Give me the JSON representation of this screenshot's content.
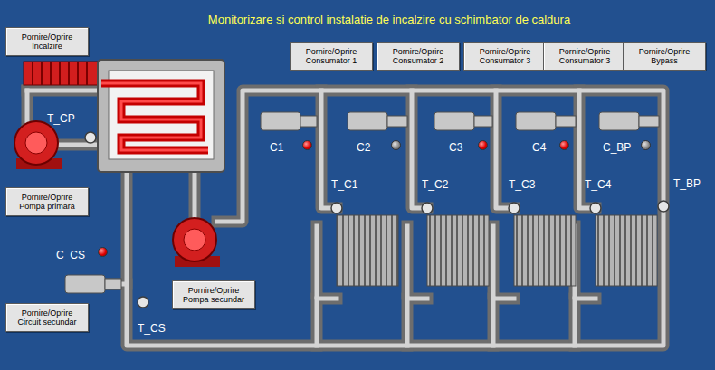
{
  "title": "Monitorizare si control instalatie de incalzire cu schimbator de caldura",
  "buttons": [
    {
      "lines": [
        "Pornire/Oprire",
        "Incalzire"
      ]
    },
    {
      "lines": [
        "Pornire/Oprire",
        "Consumator 1"
      ]
    },
    {
      "lines": [
        "Pornire/Oprire",
        "Consumator 2"
      ]
    },
    {
      "lines": [
        "Pornire/Oprire",
        "Consumator 3"
      ]
    },
    {
      "lines": [
        "Pornire/Oprire",
        "Consumator 3"
      ]
    },
    {
      "lines": [
        "Pornire/Oprire",
        "Bypass"
      ]
    },
    {
      "lines": [
        "Pornire/Oprire",
        "Pompa primara"
      ]
    },
    {
      "lines": [
        "Pornire/Oprire",
        "Circuit secundar"
      ]
    },
    {
      "lines": [
        "Pornire/Oprire",
        "Pompa secundar"
      ]
    }
  ],
  "sensors": [
    {
      "label": "T_CP"
    },
    {
      "label": "T_C1"
    },
    {
      "label": "T_C2"
    },
    {
      "label": "T_C3"
    },
    {
      "label": "T_C4"
    },
    {
      "label": "T_BP"
    },
    {
      "label": "T_CS"
    }
  ],
  "valves": [
    {
      "label": "C1",
      "on": true
    },
    {
      "label": "C2",
      "on": false
    },
    {
      "label": "C3",
      "on": true
    },
    {
      "label": "C4",
      "on": true
    },
    {
      "label": "C_BP",
      "on": false
    },
    {
      "label": "C_CS",
      "on": true
    }
  ]
}
